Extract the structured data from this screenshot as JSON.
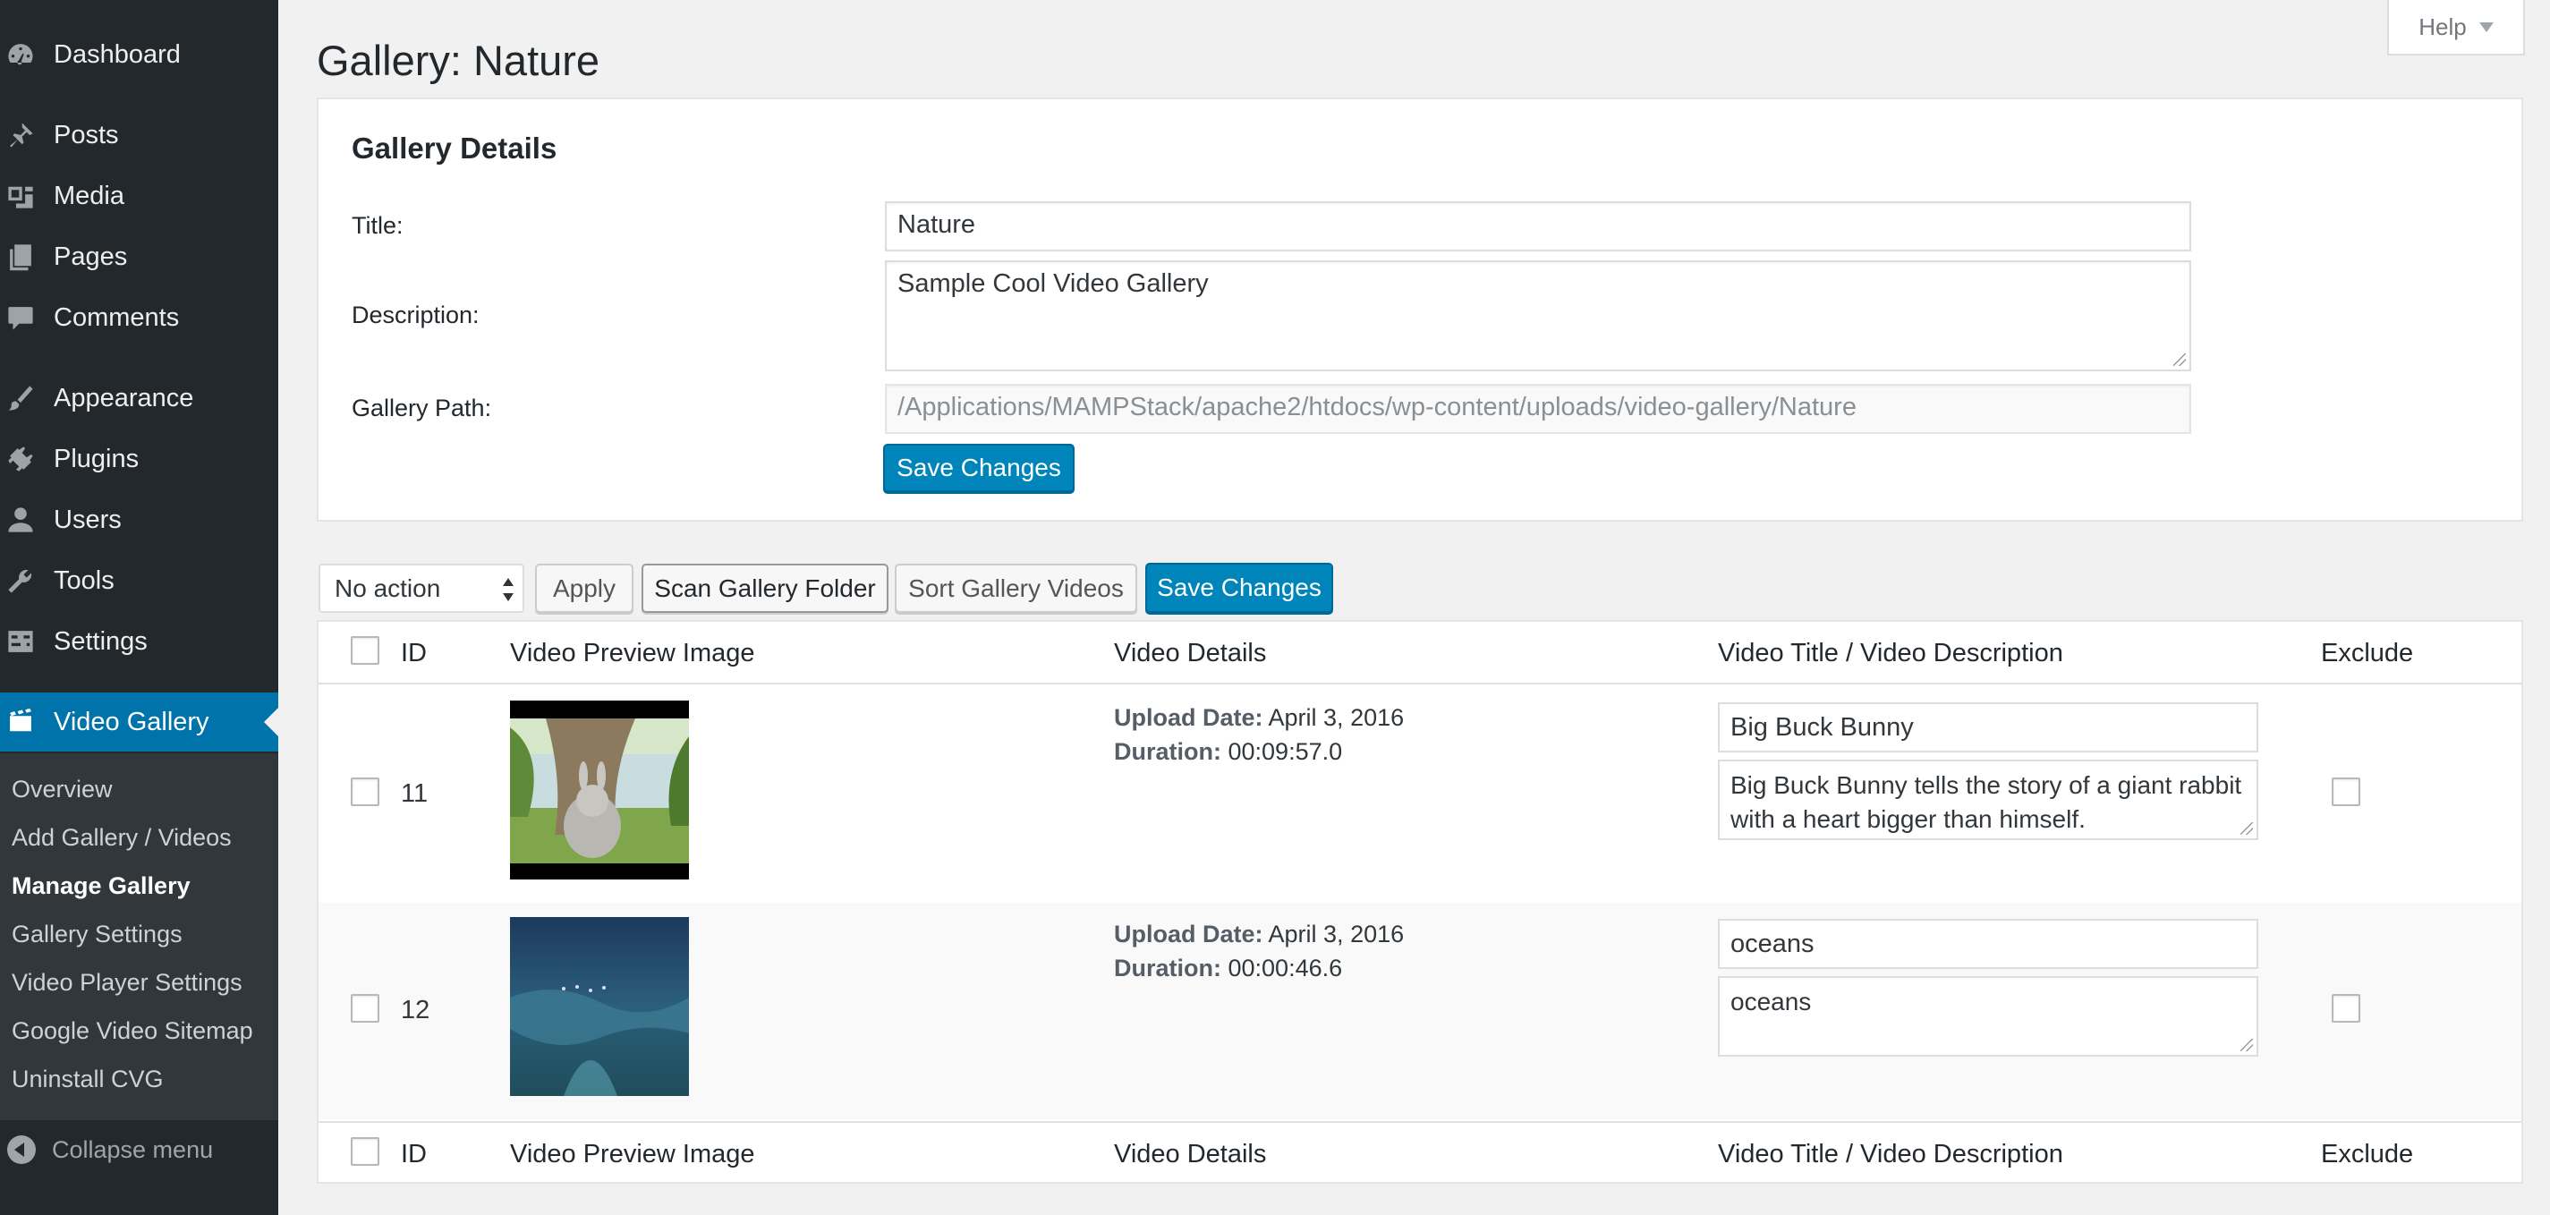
{
  "sidebar": {
    "items": [
      {
        "label": "Dashboard",
        "icon": "dashboard-icon"
      },
      {
        "label": "Posts",
        "icon": "pin-icon"
      },
      {
        "label": "Media",
        "icon": "media-icon"
      },
      {
        "label": "Pages",
        "icon": "pages-icon"
      },
      {
        "label": "Comments",
        "icon": "comment-icon"
      },
      {
        "label": "Appearance",
        "icon": "brush-icon"
      },
      {
        "label": "Plugins",
        "icon": "plug-icon"
      },
      {
        "label": "Users",
        "icon": "user-icon"
      },
      {
        "label": "Tools",
        "icon": "wrench-icon"
      },
      {
        "label": "Settings",
        "icon": "settings-icon"
      },
      {
        "label": "Video Gallery",
        "icon": "video-icon"
      }
    ],
    "submenu": [
      "Overview",
      "Add Gallery / Videos",
      "Manage Gallery",
      "Gallery Settings",
      "Video Player Settings",
      "Google Video Sitemap",
      "Uninstall CVG"
    ],
    "current_submenu": "Manage Gallery",
    "collapse_label": "Collapse menu"
  },
  "page": {
    "title": "Gallery: Nature",
    "help_label": "Help"
  },
  "details": {
    "heading": "Gallery Details",
    "title_label": "Title:",
    "title_value": "Nature",
    "description_label": "Description:",
    "description_value": "Sample Cool Video Gallery",
    "path_label": "Gallery Path:",
    "path_value": "/Applications/MAMPStack/apache2/htdocs/wp-content/uploads/video-gallery/Nature",
    "save_label": "Save Changes"
  },
  "toolbar": {
    "bulk_action": "No action",
    "apply_label": "Apply",
    "scan_label": "Scan Gallery Folder",
    "sort_label": "Sort Gallery Videos",
    "save_label": "Save Changes"
  },
  "table": {
    "columns": [
      "ID",
      "Video Preview Image",
      "Video Details",
      "Video Title / Video Description",
      "Exclude"
    ],
    "upload_date_label": "Upload Date:",
    "duration_label": "Duration:",
    "rows": [
      {
        "id": "11",
        "upload_date": "April 3, 2016",
        "duration": "00:09:57.0",
        "video_title": "Big Buck Bunny",
        "video_description": "Big Buck Bunny tells the story of a giant rabbit with a heart bigger than himself."
      },
      {
        "id": "12",
        "upload_date": "April 3, 2016",
        "duration": "00:00:46.6",
        "video_title": "oceans",
        "video_description": "oceans"
      }
    ]
  },
  "colors": {
    "sidebar_bg": "#23282d",
    "submenu_bg": "#32373c",
    "accent": "#0073aa",
    "primary_button": "#0085ba"
  }
}
